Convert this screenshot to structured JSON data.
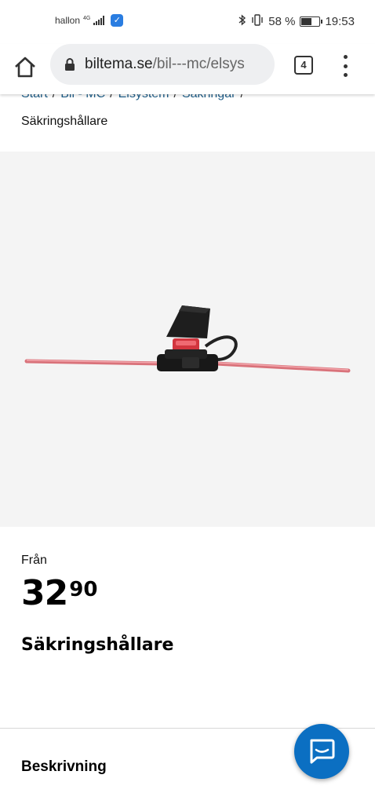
{
  "status_bar": {
    "carrier": "hallon",
    "network": "4G",
    "battery_percent": "58 %",
    "battery_level": 0.58,
    "time": "19:53"
  },
  "browser": {
    "url_host": "biltema.se",
    "url_path": "/bil---mc/elsys",
    "tab_count": "4"
  },
  "breadcrumb": {
    "items": [
      "Start",
      "Bil - MC",
      "Elsystem",
      "Säkringar"
    ],
    "separator": "/",
    "current": "Säkringshållare"
  },
  "product": {
    "image_alt": "Säkringshållare",
    "from_label": "Från",
    "price_main": "32",
    "price_decimals": "90",
    "title": "Säkringshållare"
  },
  "sections": {
    "description_label": "Beskrivning"
  },
  "colors": {
    "link": "#1f5f8a",
    "fab": "#0b6fc2",
    "image_bg": "#f4f4f4"
  }
}
